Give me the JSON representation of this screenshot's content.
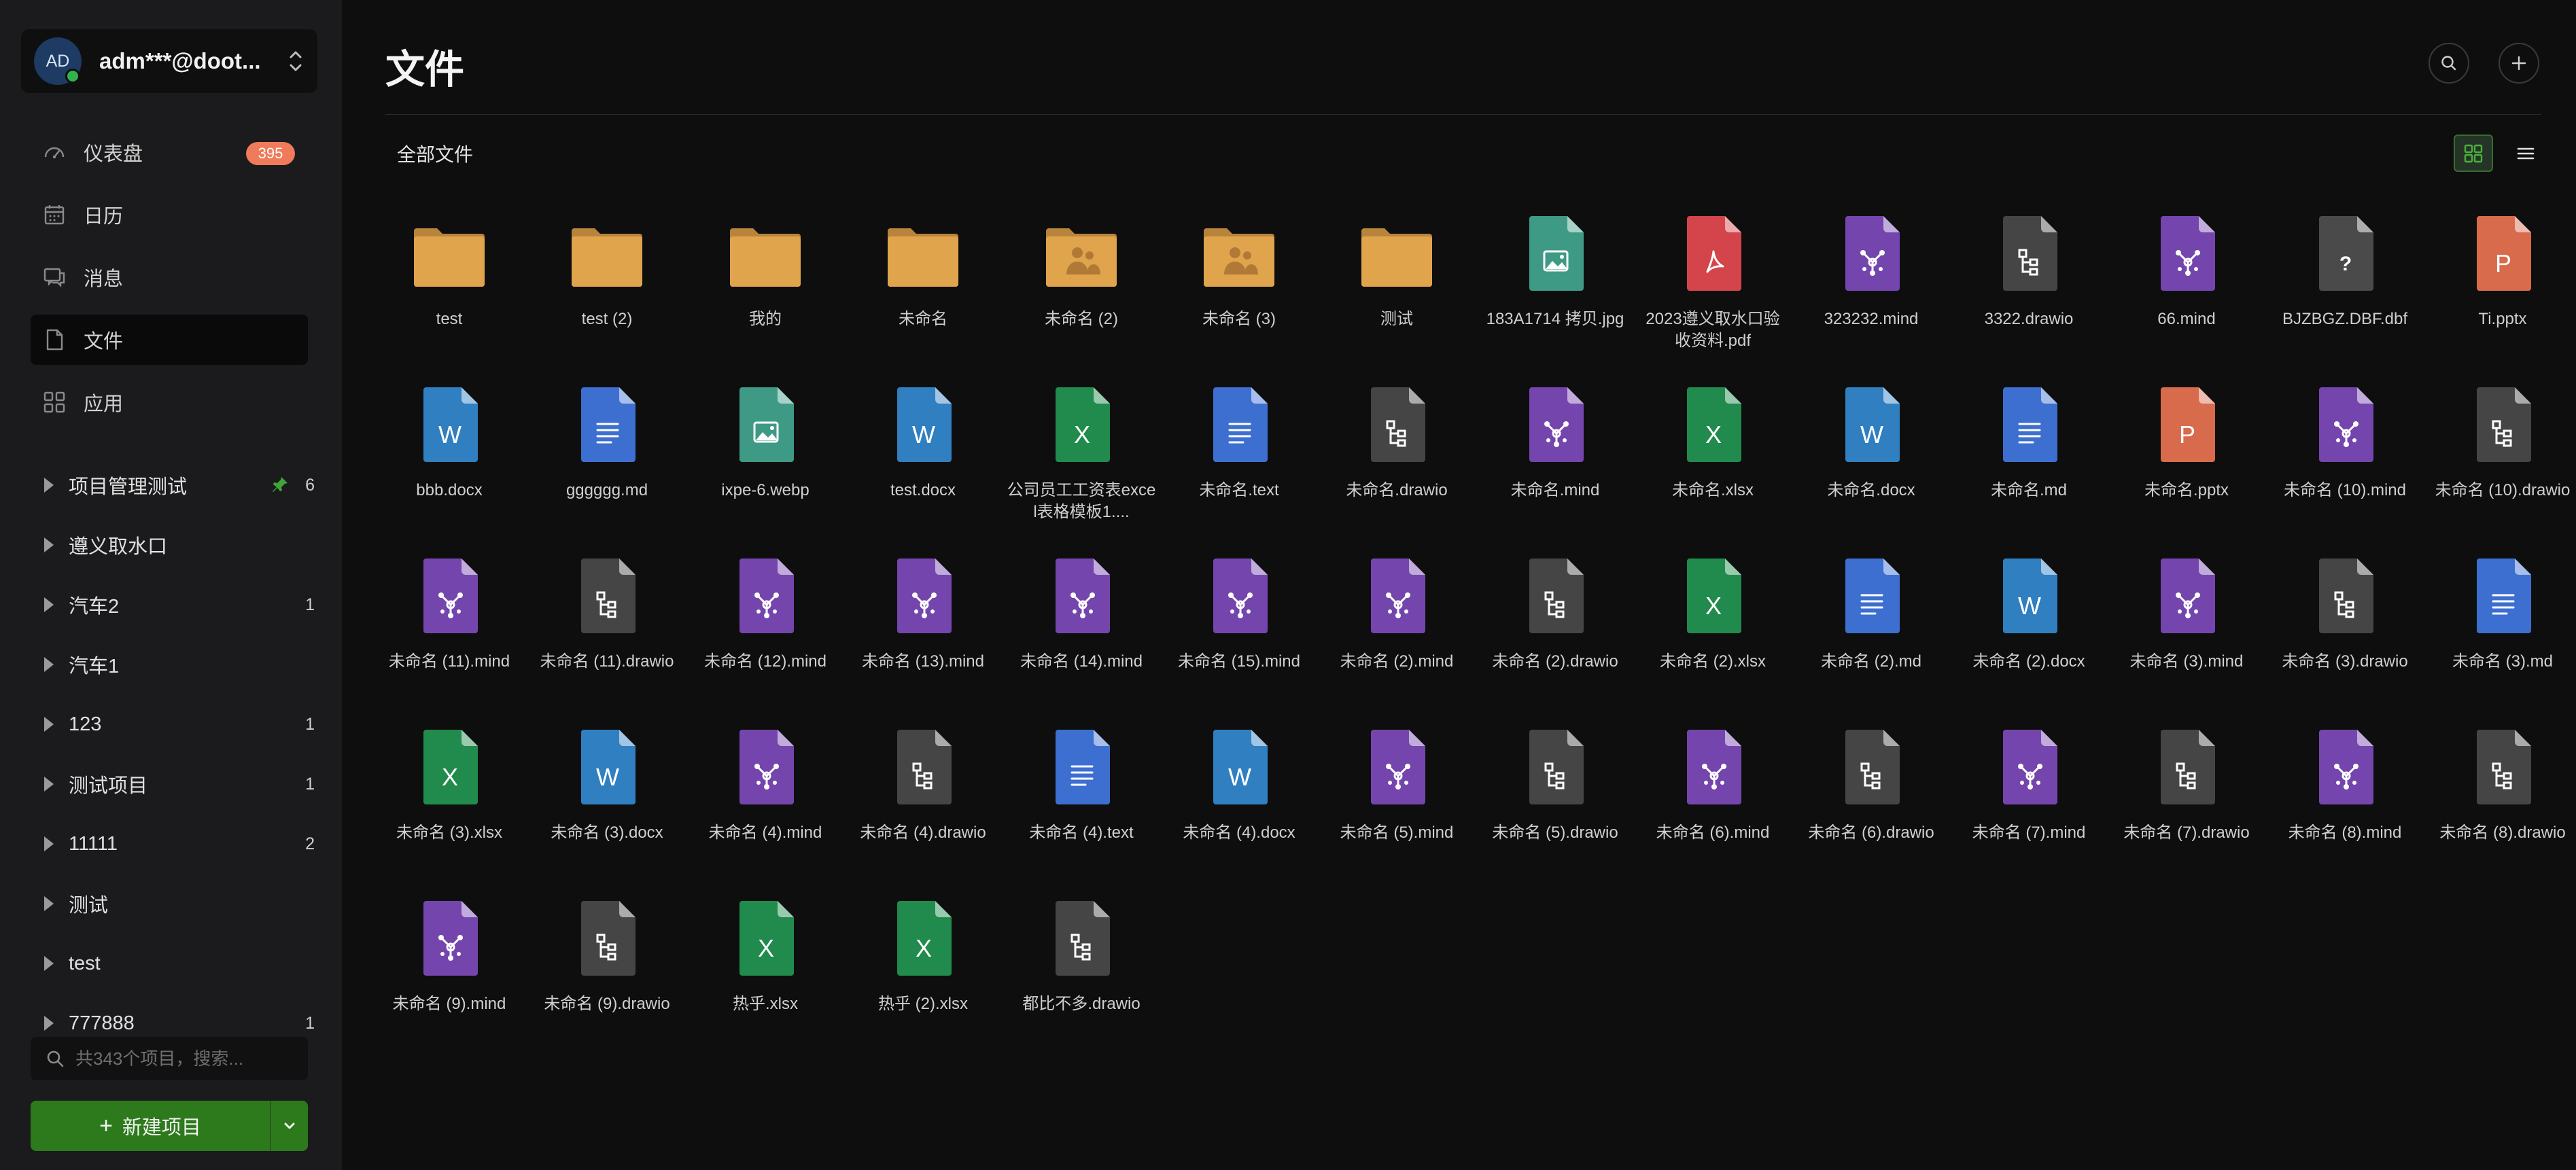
{
  "account": {
    "initials": "AD",
    "name": "adm***@doot..."
  },
  "nav": [
    {
      "label": "仪表盘",
      "icon": "dashboard-icon",
      "badge": "395"
    },
    {
      "label": "日历",
      "icon": "calendar-icon",
      "badge": ""
    },
    {
      "label": "消息",
      "icon": "message-icon",
      "badge": ""
    },
    {
      "label": "文件",
      "icon": "file-icon",
      "badge": "",
      "active": true
    },
    {
      "label": "应用",
      "icon": "apps-icon",
      "badge": ""
    }
  ],
  "projects": [
    {
      "label": "项目管理测试",
      "count": "6",
      "pinned": true
    },
    {
      "label": "遵义取水口",
      "count": ""
    },
    {
      "label": "汽车2",
      "count": "1"
    },
    {
      "label": "汽车1",
      "count": ""
    },
    {
      "label": "123",
      "count": "1"
    },
    {
      "label": "测试项目",
      "count": "1"
    },
    {
      "label": "11111",
      "count": "2"
    },
    {
      "label": "测试",
      "count": ""
    },
    {
      "label": "test",
      "count": ""
    },
    {
      "label": "777888",
      "count": "1"
    }
  ],
  "search": {
    "placeholder": "共343个项目，搜索..."
  },
  "new_project": {
    "label": "新建项目"
  },
  "main": {
    "title": "文件",
    "breadcrumb": "全部文件"
  },
  "colors": {
    "folder": "#e0a54c",
    "image": "#3f9a85",
    "pdf": "#d4444b",
    "mind": "#7446ad",
    "drawio": "#454545",
    "unknown": "#4a4a4a",
    "pptx": "#d86b4c",
    "docx": "#2f7fc1",
    "md": "#3d6fd0",
    "xlsx": "#218a4d",
    "accent": "#2d7a1c"
  },
  "files": [
    {
      "name": "test",
      "type": "folder"
    },
    {
      "name": "test (2)",
      "type": "folder"
    },
    {
      "name": "我的",
      "type": "folder"
    },
    {
      "name": "未命名",
      "type": "folder"
    },
    {
      "name": "未命名 (2)",
      "type": "shared-folder"
    },
    {
      "name": "未命名 (3)",
      "type": "shared-folder"
    },
    {
      "name": "测试",
      "type": "folder"
    },
    {
      "name": "183A1714 拷贝.jpg",
      "type": "image"
    },
    {
      "name": "2023遵义取水口验收资料.pdf",
      "type": "pdf"
    },
    {
      "name": "323232.mind",
      "type": "mind"
    },
    {
      "name": "3322.drawio",
      "type": "drawio"
    },
    {
      "name": "66.mind",
      "type": "mind"
    },
    {
      "name": "BJZBGZ.DBF.dbf",
      "type": "unknown"
    },
    {
      "name": "Ti.pptx",
      "type": "pptx"
    },
    {
      "name": "bbb.docx",
      "type": "docx"
    },
    {
      "name": "gggggg.md",
      "type": "md"
    },
    {
      "name": "ixpe-6.webp",
      "type": "image"
    },
    {
      "name": "test.docx",
      "type": "docx"
    },
    {
      "name": "公司员工工资表excel表格模板1....",
      "type": "xlsx"
    },
    {
      "name": "未命名.text",
      "type": "md"
    },
    {
      "name": "未命名.drawio",
      "type": "drawio"
    },
    {
      "name": "未命名.mind",
      "type": "mind"
    },
    {
      "name": "未命名.xlsx",
      "type": "xlsx"
    },
    {
      "name": "未命名.docx",
      "type": "docx"
    },
    {
      "name": "未命名.md",
      "type": "md"
    },
    {
      "name": "未命名.pptx",
      "type": "pptx"
    },
    {
      "name": "未命名 (10).mind",
      "type": "mind"
    },
    {
      "name": "未命名 (10).drawio",
      "type": "drawio"
    },
    {
      "name": "未命名 (11).mind",
      "type": "mind"
    },
    {
      "name": "未命名 (11).drawio",
      "type": "drawio"
    },
    {
      "name": "未命名 (12).mind",
      "type": "mind"
    },
    {
      "name": "未命名 (13).mind",
      "type": "mind"
    },
    {
      "name": "未命名 (14).mind",
      "type": "mind"
    },
    {
      "name": "未命名 (15).mind",
      "type": "mind"
    },
    {
      "name": "未命名 (2).mind",
      "type": "mind"
    },
    {
      "name": "未命名 (2).drawio",
      "type": "drawio"
    },
    {
      "name": "未命名 (2).xlsx",
      "type": "xlsx"
    },
    {
      "name": "未命名 (2).md",
      "type": "md"
    },
    {
      "name": "未命名 (2).docx",
      "type": "docx"
    },
    {
      "name": "未命名 (3).mind",
      "type": "mind"
    },
    {
      "name": "未命名 (3).drawio",
      "type": "drawio"
    },
    {
      "name": "未命名 (3).md",
      "type": "md"
    },
    {
      "name": "未命名 (3).xlsx",
      "type": "xlsx"
    },
    {
      "name": "未命名 (3).docx",
      "type": "docx"
    },
    {
      "name": "未命名 (4).mind",
      "type": "mind"
    },
    {
      "name": "未命名 (4).drawio",
      "type": "drawio"
    },
    {
      "name": "未命名 (4).text",
      "type": "md"
    },
    {
      "name": "未命名 (4).docx",
      "type": "docx"
    },
    {
      "name": "未命名 (5).mind",
      "type": "mind"
    },
    {
      "name": "未命名 (5).drawio",
      "type": "drawio"
    },
    {
      "name": "未命名 (6).mind",
      "type": "mind"
    },
    {
      "name": "未命名 (6).drawio",
      "type": "drawio"
    },
    {
      "name": "未命名 (7).mind",
      "type": "mind"
    },
    {
      "name": "未命名 (7).drawio",
      "type": "drawio"
    },
    {
      "name": "未命名 (8).mind",
      "type": "mind"
    },
    {
      "name": "未命名 (8).drawio",
      "type": "drawio"
    },
    {
      "name": "未命名 (9).mind",
      "type": "mind"
    },
    {
      "name": "未命名 (9).drawio",
      "type": "drawio"
    },
    {
      "name": "热乎.xlsx",
      "type": "xlsx"
    },
    {
      "name": "热乎 (2).xlsx",
      "type": "xlsx"
    },
    {
      "name": "都比不多.drawio",
      "type": "drawio"
    }
  ]
}
